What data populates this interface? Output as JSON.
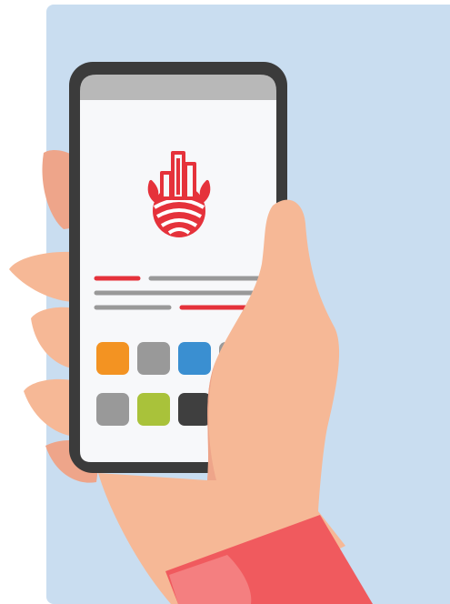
{
  "colors": {
    "background": "#c9ddf0",
    "phone_frame": "#3b3b3b",
    "phone_top_bar": "#b8b8b8",
    "screen": "#f7f8fa",
    "logo_red": "#e5323b",
    "line_gray": "#999999",
    "skin": "#f6b896",
    "skin_shadow": "#eea58a",
    "sleeve": "#f05a5e",
    "sleeve_light": "#f47f80"
  },
  "app_tiles": [
    {
      "color": "#f39322",
      "name": "orange-tile"
    },
    {
      "color": "#999999",
      "name": "gray-tile-1"
    },
    {
      "color": "#3a8fd1",
      "name": "blue-tile"
    },
    {
      "color": "#999999",
      "name": "gray-tile-2"
    },
    {
      "color": "#999999",
      "name": "gray-tile-3"
    },
    {
      "color": "#a9c23a",
      "name": "green-tile"
    },
    {
      "color": "#3f3f3f",
      "name": "dark-tile"
    },
    {
      "color": "#23b2a9",
      "name": "teal-tile"
    }
  ],
  "icons": [
    "city-farm-logo-icon",
    "hand-icon"
  ]
}
